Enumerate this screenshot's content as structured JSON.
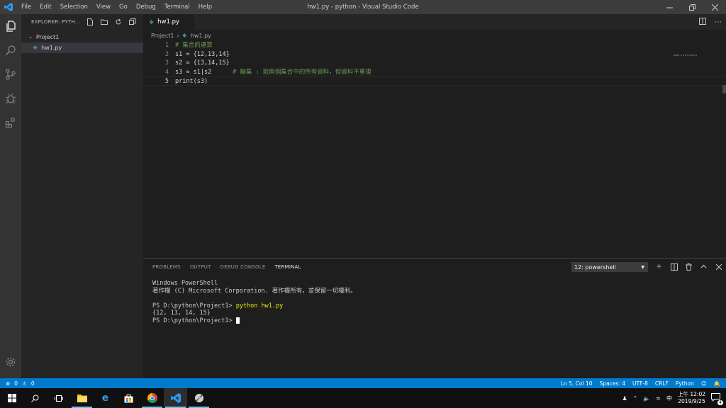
{
  "titlebar": {
    "menu": [
      "File",
      "Edit",
      "Selection",
      "View",
      "Go",
      "Debug",
      "Terminal",
      "Help"
    ],
    "title": "hw1.py - python - Visual Studio Code"
  },
  "sidebar": {
    "header": "EXPLORER: PYTH...",
    "folder": "Project1",
    "file": "hw1.py"
  },
  "editor": {
    "tab": "hw1.py",
    "breadcrumb": {
      "folder": "Project1",
      "file": "hw1.py"
    },
    "lines": [
      {
        "num": "1",
        "code": "# 集合的運算"
      },
      {
        "num": "2",
        "code": "s1 = {12,13,14}"
      },
      {
        "num": "3",
        "code": "s2 = {13,14,15}"
      },
      {
        "num": "4",
        "code": "s3 = s1|s2",
        "comment": "# 聯集 : 取兩個集合中的所有資料，但資料不重複"
      },
      {
        "num": "5",
        "code": "print(s3)"
      }
    ]
  },
  "panel": {
    "tabs": [
      "PROBLEMS",
      "OUTPUT",
      "DEBUG CONSOLE",
      "TERMINAL"
    ],
    "terminal_select": "12: powershell",
    "terminal": {
      "line1": "Windows PowerShell",
      "line2": "著作權 (C) Microsoft Corporation. 著作權所有，並保留一切權利。",
      "prompt1": "PS D:\\python\\Project1> ",
      "command": "python hw1.py",
      "output": "{12, 13, 14, 15}",
      "prompt2": "PS D:\\python\\Project1> "
    }
  },
  "statusbar": {
    "errors": "0",
    "warnings": "0",
    "position": "Ln 5, Col 10",
    "spaces": "Spaces: 4",
    "encoding": "UTF-8",
    "eol": "CRLF",
    "language": "Python"
  },
  "taskbar": {
    "ime": "中",
    "time": "上午 12:02",
    "date": "2019/9/25",
    "notifications": "4"
  }
}
